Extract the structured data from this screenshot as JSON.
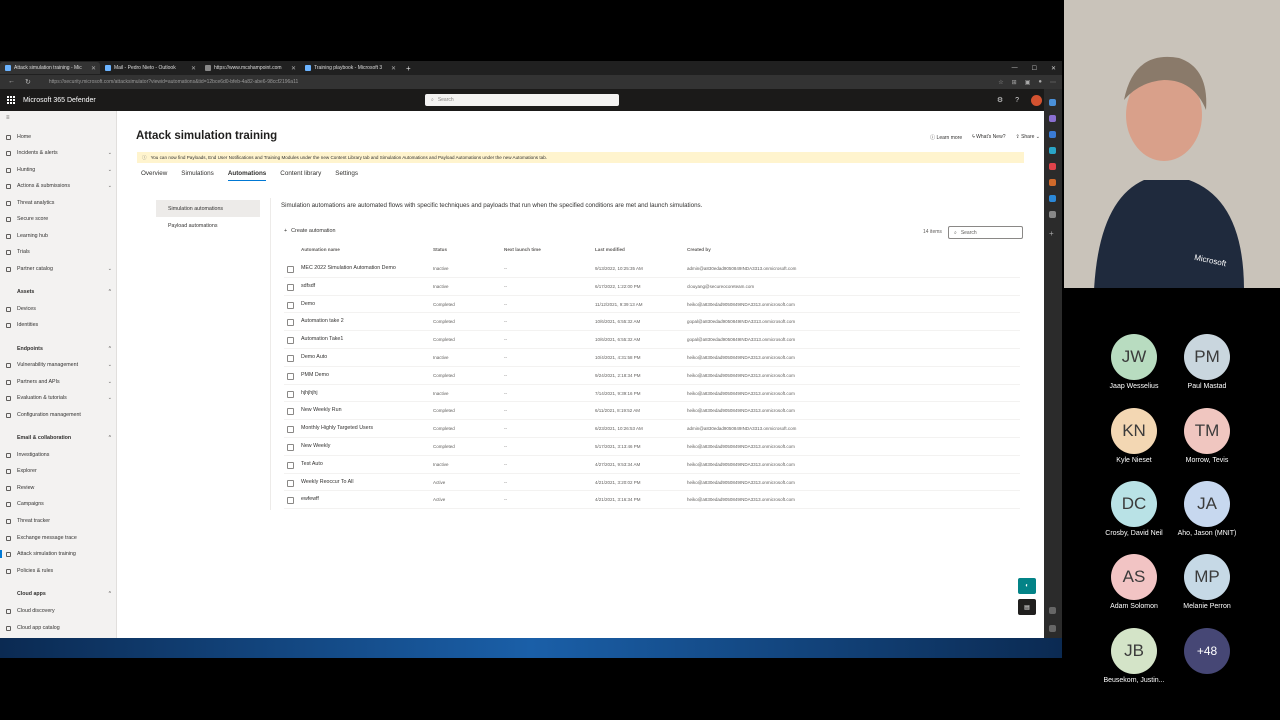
{
  "browser": {
    "tabs": [
      {
        "label": "Attack simulation training - Mic"
      },
      {
        "label": "Mail - Pedro Nieto - Outlook"
      },
      {
        "label": "https://www.mcshampoint.com"
      },
      {
        "label": "Training playbook - Microsoft 3"
      }
    ],
    "url": "https://security.microsoft.com/attacksimulator?viewid=automations&tid=12bce6d0-bfeb-4a82-abe6-98ccf2196a11"
  },
  "suite": {
    "brand": "Microsoft 365 Defender",
    "search_placeholder": "Search"
  },
  "nav": [
    {
      "label": "Home"
    },
    {
      "label": "Incidents & alerts"
    },
    {
      "label": "Hunting"
    },
    {
      "label": "Actions & submissions"
    },
    {
      "label": "Threat analytics"
    },
    {
      "label": "Secure score"
    },
    {
      "label": "Learning hub"
    },
    {
      "label": "Trials"
    },
    {
      "label": "Partner catalog"
    },
    {
      "label": "Assets"
    },
    {
      "label": "Devices"
    },
    {
      "label": "Identities"
    },
    {
      "label": "Endpoints"
    },
    {
      "label": "Vulnerability management"
    },
    {
      "label": "Partners and APIs"
    },
    {
      "label": "Evaluation & tutorials"
    },
    {
      "label": "Configuration management"
    },
    {
      "label": "Email & collaboration"
    },
    {
      "label": "Investigations"
    },
    {
      "label": "Explorer"
    },
    {
      "label": "Review"
    },
    {
      "label": "Campaigns"
    },
    {
      "label": "Threat tracker"
    },
    {
      "label": "Exchange message trace"
    },
    {
      "label": "Attack simulation training"
    },
    {
      "label": "Policies & rules"
    },
    {
      "label": "Cloud apps"
    },
    {
      "label": "Cloud discovery"
    },
    {
      "label": "Cloud app catalog"
    }
  ],
  "page": {
    "title": "Attack simulation training",
    "learn_more": "Learn more",
    "whats_new": "What's New?",
    "share": "Share",
    "banner": "You can now find Payloads, End User Notifications and Training Modules under the new Content Library tab and Simulation Automations and Payload Automations under the new Automations tab.",
    "tabs": [
      "Overview",
      "Simulations",
      "Automations",
      "Content library",
      "Settings"
    ],
    "subnav": [
      "Simulation automations",
      "Payload automations"
    ],
    "description": "Simulation automations are automated flows with specific techniques and payloads that run when the specified conditions are met and launch simulations.",
    "create_label": "Create automation",
    "items_count": "14 items",
    "table_search": "Search",
    "columns": [
      "Automation name",
      "Status",
      "Next launch time",
      "Last modified",
      "Created by"
    ]
  },
  "rows": [
    {
      "name": "MEC 2022 Simulation Automation Demo",
      "status": "Inactive",
      "next": "--",
      "modified": "9/13/2022, 10:25:35 AM",
      "by": "admin@a830edad9050849INDA3313.onmicrosoft.com"
    },
    {
      "name": "sdfsdf",
      "status": "Inactive",
      "next": "--",
      "modified": "6/17/2022, 1:22:00 PM",
      "by": "clouyang@secureocoreteam.com"
    },
    {
      "name": "Demo",
      "status": "Completed",
      "next": "--",
      "modified": "11/12/2021, 9:39:13 AM",
      "by": "heiko@a830edad9050849INDA3313.onmicrosoft.com"
    },
    {
      "name": "Automation take 2",
      "status": "Completed",
      "next": "--",
      "modified": "10/6/2021, 6:55:32 AM",
      "by": "gopal@a830edad9050849INDA3313.onmicrosoft.com"
    },
    {
      "name": "Automation Take1",
      "status": "Completed",
      "next": "--",
      "modified": "10/6/2021, 6:55:32 AM",
      "by": "gopal@a830edad9050849INDA3313.onmicrosoft.com"
    },
    {
      "name": "Demo Auto",
      "status": "Inactive",
      "next": "--",
      "modified": "10/4/2021, 4:31:58 PM",
      "by": "heiko@a830edad9050849INDA3313.onmicrosoft.com"
    },
    {
      "name": "PMM Demo",
      "status": "Completed",
      "next": "--",
      "modified": "9/24/2021, 2:18:34 PM",
      "by": "heiko@a830edad9050849INDA3313.onmicrosoft.com"
    },
    {
      "name": "hjhjhjhj",
      "status": "Inactive",
      "next": "--",
      "modified": "7/14/2021, 9:39:16 PM",
      "by": "heiko@a830edad9050849INDA3313.onmicrosoft.com"
    },
    {
      "name": "New Weekly Run",
      "status": "Completed",
      "next": "--",
      "modified": "6/11/2021, 8:19:52 AM",
      "by": "heiko@a830edad9050849INDA3313.onmicrosoft.com"
    },
    {
      "name": "Monthly Highly Targeted Users",
      "status": "Completed",
      "next": "--",
      "modified": "6/23/2021, 10:26:53 AM",
      "by": "admin@a830edad9050849INDA3313.onmicrosoft.com"
    },
    {
      "name": "New Weekly",
      "status": "Completed",
      "next": "--",
      "modified": "5/17/2021, 3:13:46 PM",
      "by": "heiko@a830edad9050849INDA3313.onmicrosoft.com"
    },
    {
      "name": "Test Auto",
      "status": "Inactive",
      "next": "--",
      "modified": "4/27/2021, 9:53:34 AM",
      "by": "heiko@a830edad9050849INDA3313.onmicrosoft.com"
    },
    {
      "name": "Weekly Reoccur To All",
      "status": "Active",
      "next": "--",
      "modified": "4/21/2021, 3:20:02 PM",
      "by": "heiko@a830edad9050849INDA3313.onmicrosoft.com"
    },
    {
      "name": "ewfewff",
      "status": "Active",
      "next": "--",
      "modified": "4/21/2021, 3:16:34 PM",
      "by": "heiko@a830edad9050849INDA3313.onmicrosoft.com"
    }
  ],
  "participants": [
    {
      "initials": "JW",
      "name": "Jaap Wesselius",
      "color": "#b8dcc0"
    },
    {
      "initials": "PM",
      "name": "Paul Mastad",
      "color": "#c9d6de"
    },
    {
      "initials": "KN",
      "name": "Kyle Nieset",
      "color": "#f3d7b3"
    },
    {
      "initials": "TM",
      "name": "Morrow, Tevis",
      "color": "#f0c6c0"
    },
    {
      "initials": "DC",
      "name": "Crosby, David Neil",
      "color": "#b9e2e6"
    },
    {
      "initials": "JA",
      "name": "Aho, Jason (MNIT)",
      "color": "#c7d8ef"
    },
    {
      "initials": "AS",
      "name": "Adam Solomon",
      "color": "#f2c4c4"
    },
    {
      "initials": "MP",
      "name": "Melanie Perron",
      "color": "#c6d9e6"
    },
    {
      "initials": "JB",
      "name": "Beusekom, Justin...",
      "color": "#d4e4c8"
    }
  ],
  "more_participants": "+48",
  "watermark": "Microsoft"
}
